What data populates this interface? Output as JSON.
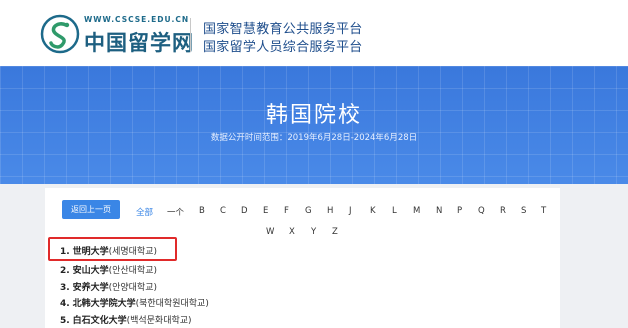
{
  "header": {
    "logo_url": "WWW.CSCSE.EDU.CN",
    "logo_name": "中国留学网",
    "platform_line1": "国家智慧教育公共服务平台",
    "platform_line2": "国家留学人员综合服务平台"
  },
  "banner": {
    "title": "韩国院校",
    "subtitle": "数据公开时间范围：2019年6月28日-2024年6月28日"
  },
  "nav": {
    "back_label": "返回上一页",
    "all_label": "全部",
    "dash_label": "一个",
    "letters_row1": [
      "B",
      "C",
      "D",
      "E",
      "F",
      "G",
      "H",
      "J",
      "K",
      "L",
      "M",
      "N",
      "P",
      "Q",
      "R",
      "S",
      "T"
    ],
    "letters_row2": [
      "W",
      "X",
      "Y",
      "Z"
    ]
  },
  "schools": [
    {
      "num": "1.",
      "cn": "世明大学",
      "kr": "(세명대학교)"
    },
    {
      "num": "2.",
      "cn": "安山大学",
      "kr": "(안산대학교)"
    },
    {
      "num": "3.",
      "cn": "安养大学",
      "kr": "(안양대학교)"
    },
    {
      "num": "4.",
      "cn": "北韩大学院大学",
      "kr": "(북한대학원대학교)"
    },
    {
      "num": "5.",
      "cn": "白石文化大学",
      "kr": "(백석문화대학교)"
    }
  ],
  "colors": {
    "banner_blue": "#3e7fe0",
    "button_blue": "#3a86e6",
    "highlight_red": "#e02a2a",
    "brand_teal": "#1d5f80"
  }
}
